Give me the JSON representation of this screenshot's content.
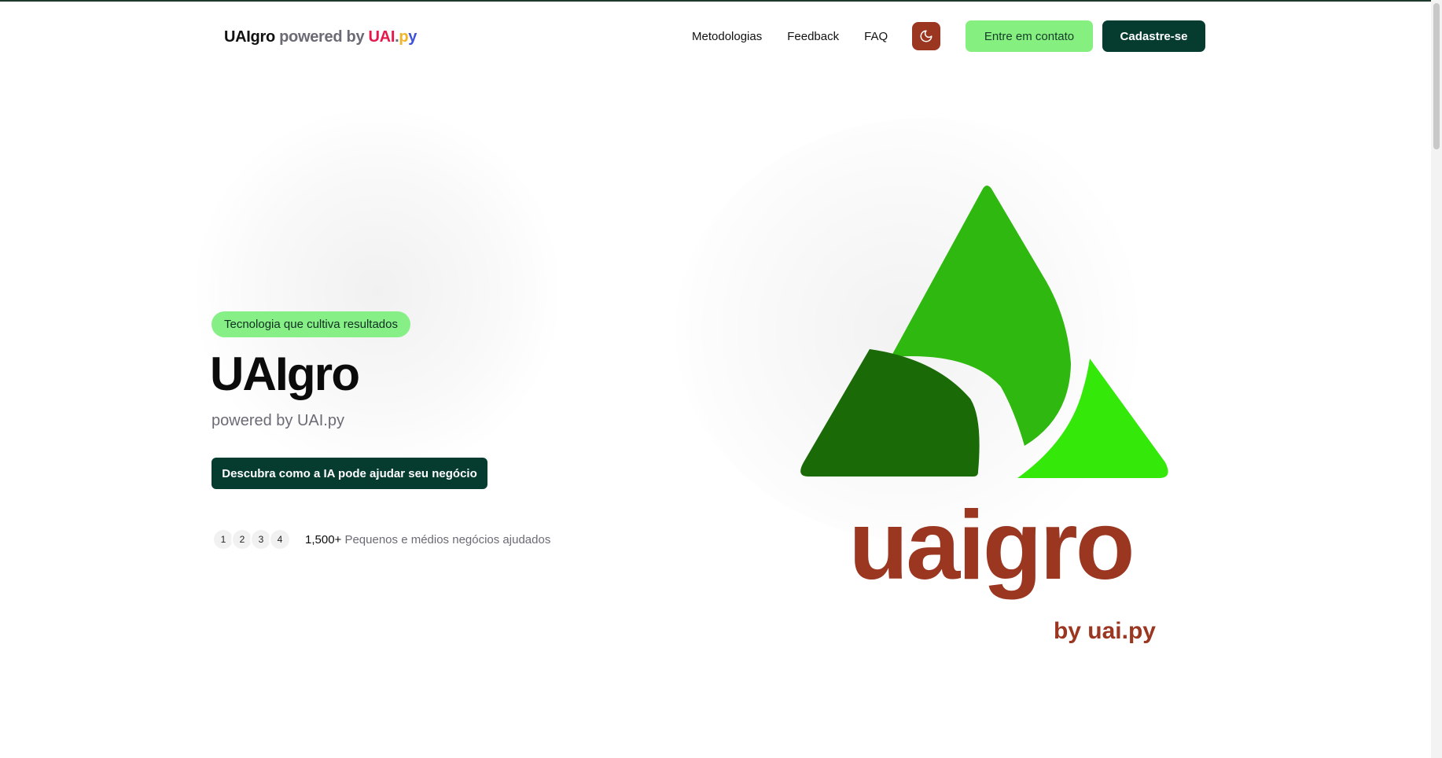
{
  "header": {
    "brand": {
      "name": "UAIgro",
      "powered_by": " powered by ",
      "uai": "UAI",
      "dot": ".",
      "p": "p",
      "y": "y"
    },
    "nav": [
      {
        "label": "Metodologias"
      },
      {
        "label": "Feedback"
      },
      {
        "label": "FAQ"
      }
    ],
    "theme_toggle_icon": "moon-icon",
    "contact_button": "Entre em contato",
    "signup_button": "Cadastre-se"
  },
  "hero": {
    "badge": "Tecnologia que cultiva resultados",
    "title": "UAIgro",
    "subtitle": "powered by UAI.py",
    "cta": "Descubra como a IA pode ajudar seu negócio",
    "avatars": [
      "1",
      "2",
      "3",
      "4"
    ],
    "stats_count": "1,500+",
    "stats_description": " Pequenos e médios negócios ajudados"
  },
  "logo": {
    "wordmark": "uaigro",
    "byline": "by uai.py"
  },
  "colors": {
    "dark_green": "#063b30",
    "light_green": "#85f07f",
    "brand_brown": "#9b3621",
    "leaf_bright": "#34e80a",
    "leaf_mid": "#2fb80f",
    "leaf_dark": "#1a6b08"
  }
}
